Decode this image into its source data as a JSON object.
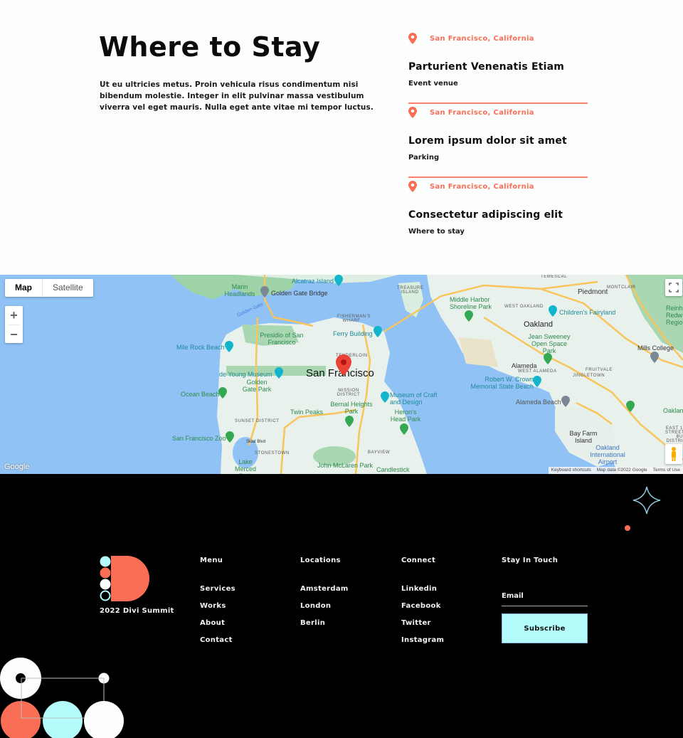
{
  "section": {
    "title": "Where to Stay",
    "intro": "Ut eu ultricies metus. Proin vehicula risus condimentum nisi bibendum molestie. Integer in elit pulvinar massa vestibulum viverra vel eget mauris. Nulla eget ante vitae mi tempor luctus."
  },
  "venues": [
    {
      "location": "San Francisco, California",
      "name": "Parturient Venenatis Etiam",
      "type": "Event venue"
    },
    {
      "location": "San Francisco, California",
      "name": "Lorem ipsum dolor sit amet",
      "type": "Parking"
    },
    {
      "location": "San Francisco, California",
      "name": "Consectetur adipiscing elit",
      "type": "Where to stay"
    }
  ],
  "map": {
    "type_options": [
      "Map",
      "Satellite"
    ],
    "selected_type": "Map",
    "zoom_in": "+",
    "zoom_out": "−",
    "logo": "Google",
    "attribution": [
      "Keyboard shortcuts",
      "Map data ©2022 Google",
      "Terms of Use"
    ],
    "icons": {
      "fullscreen": "fullscreen-icon",
      "pegman": "street-view-pegman-icon",
      "marker": "map-marker-icon"
    },
    "labels": {
      "main_city": "San Francisco",
      "oakland": "Oakland",
      "piedmont": "Piedmont",
      "alameda": "Alameda",
      "alcatraz": "Alcatraz Island",
      "golden_gate_bridge": "Golden Gate Bridge",
      "marin": "Marin Headlands",
      "golden_gate": "Golden Gate",
      "fishermans_wharf": "FISHERMAN'S WHARF",
      "ferry_building": "Ferry Building",
      "presidio": "Presidio of San Francisco",
      "mile_rock": "Mile Rock Beach",
      "de_young": "de Young Museum",
      "golden_gate_park": "Golden Gate Park",
      "ocean_beach": "Ocean Beach",
      "tenderloin": "TENDERLOIN",
      "mission": "MISSION DISTRICT",
      "museum_craft": "Museum of Craft and Design",
      "twin_peaks": "Twin Peaks",
      "bernal": "Bernal Heights Park",
      "herons_head": "Heron's Head Park",
      "sunset": "SUNSET DISTRICT",
      "sf_zoo": "San Francisco Zoo",
      "sloat": "Sloat Blvd",
      "stonestown": "STONESTOWN",
      "lake_merced": "Lake Merced Park",
      "mclaren": "John McLaren Park",
      "bayview": "BAYVIEW",
      "candlestick": "Candlestick",
      "treasure_island": "TREASURE ISLAND",
      "middle_harbor": "Middle Harbor Shoreline Park",
      "west_oakland": "WEST OAKLAND",
      "temescal": "TEMESCAL",
      "montclair": "MONTCLAIR",
      "childrens_fairyland": "Children's Fairyland",
      "jean_sweeney": "Jean Sweeney Open Space Park",
      "mills_college": "Mills College",
      "west_alameda": "WEST ALAMEDA",
      "fruitvale": "FRUITVALE",
      "jingletown": "JINGLETOWN",
      "robert_crown": "Robert W. Crown Memorial State Beach",
      "alameda_beach": "Alameda Beach",
      "bay_farm": "Bay Farm Island",
      "oakland_airport": "Oakland International Airport",
      "reinhardt": "Reinh Redw Region",
      "oakland_zoo": "Oaklan",
      "east14": "EAST 1 STREET BU DISTRI"
    }
  },
  "footer": {
    "brand": "2022 Divi Summit",
    "columns": [
      {
        "heading": "Menu",
        "items": [
          "Services",
          "Works",
          "About",
          "Contact"
        ]
      },
      {
        "heading": "Locations",
        "items": [
          "Amsterdam",
          "London",
          "Berlin"
        ]
      },
      {
        "heading": "Connect",
        "items": [
          "Linkedin",
          "Facebook",
          "Twitter",
          "Instagram"
        ]
      }
    ],
    "newsletter": {
      "heading": "Stay In Touch",
      "email_placeholder": "Email",
      "button": "Subscribe"
    }
  },
  "colors": {
    "accent": "#f96e55",
    "cyan": "#b4fbfb",
    "footer_bg": "#000000",
    "page_bg": "#fcfefd"
  }
}
